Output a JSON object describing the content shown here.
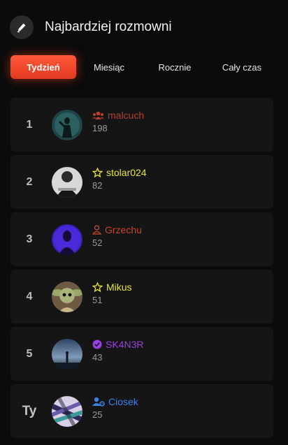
{
  "header": {
    "title": "Najbardziej rozmowni",
    "icon": "pen-icon"
  },
  "tabs": [
    {
      "label": "Tydzień",
      "active": true
    },
    {
      "label": "Miesiąc",
      "active": false
    },
    {
      "label": "Rocznie",
      "active": false
    },
    {
      "label": "Cały czas",
      "active": false
    }
  ],
  "rows": [
    {
      "rank": "1",
      "name": "malcuch",
      "count": "198",
      "icon": "users-icon",
      "color": "#b3402f"
    },
    {
      "rank": "2",
      "name": "stolar024",
      "count": "82",
      "icon": "star-icon",
      "color": "#e8e33a"
    },
    {
      "rank": "3",
      "name": "Grzechu",
      "count": "52",
      "icon": "user-icon",
      "color": "#c8452f"
    },
    {
      "rank": "4",
      "name": "Mikus",
      "count": "51",
      "icon": "star-icon",
      "color": "#e8e33a"
    },
    {
      "rank": "5",
      "name": "SK4N3R",
      "count": "43",
      "icon": "verified-icon",
      "color": "#9a3fe6"
    },
    {
      "rank": "Ty",
      "name": "Ciosek",
      "count": "25",
      "icon": "user-cog-icon",
      "color": "#3f7fe6"
    }
  ]
}
